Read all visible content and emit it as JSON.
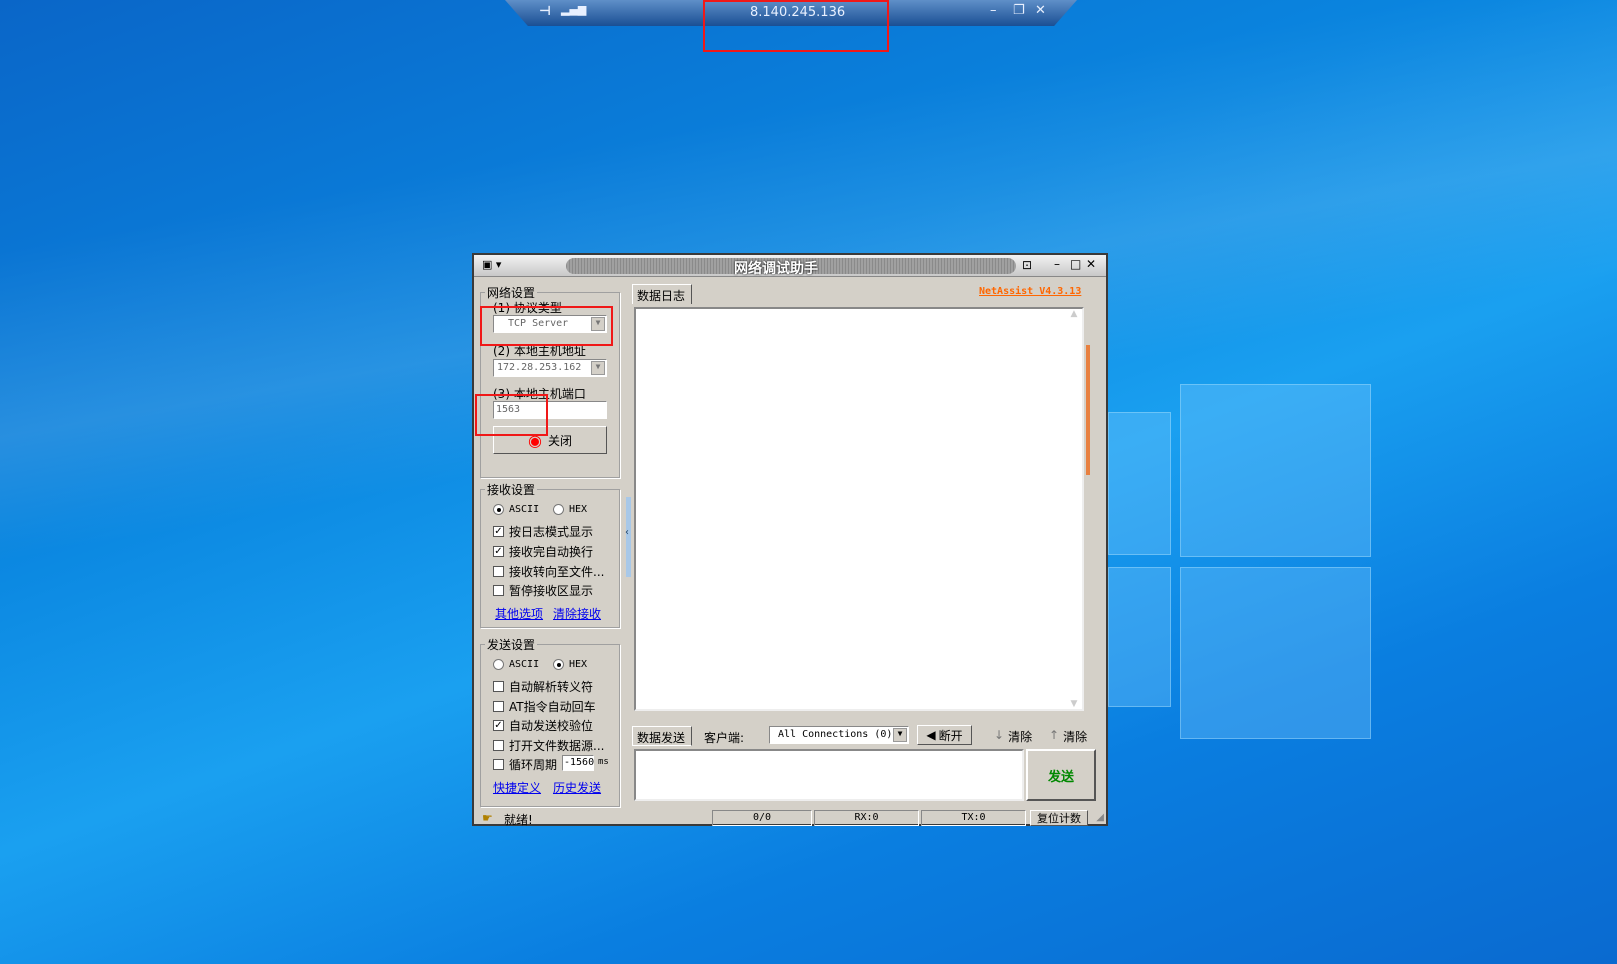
{
  "rdp_bar": {
    "host": "8.140.245.136"
  },
  "app": {
    "title": "网络调试助手",
    "version": "NetAssist V4.3.13",
    "accent": "#ff6600"
  },
  "net": {
    "title": "网络设置",
    "protocol_label": "(1) 协议类型",
    "protocol_value": "TCP Server",
    "host_label": "(2) 本地主机地址",
    "host_value": "172.28.253.162",
    "port_label": "(3) 本地主机端口",
    "port_value": "1563",
    "close_label": "关闭"
  },
  "recv": {
    "title": "接收设置",
    "ascii": "ASCII",
    "hex": "HEX",
    "options": [
      {
        "label": "按日志模式显示",
        "checked": true
      },
      {
        "label": "接收完自动换行",
        "checked": true
      },
      {
        "label": "接收转向至文件...",
        "checked": false
      },
      {
        "label": "暂停接收区显示",
        "checked": false
      }
    ],
    "link_more": "其他选项",
    "link_clear": "清除接收",
    "mode": "ASCII"
  },
  "send": {
    "title": "发送设置",
    "ascii": "ASCII",
    "hex": "HEX",
    "mode": "HEX",
    "options": [
      {
        "label": "自动解析转义符",
        "checked": false
      },
      {
        "label": "AT指令自动回车",
        "checked": false
      },
      {
        "label": "自动发送校验位",
        "checked": true
      },
      {
        "label": "打开文件数据源...",
        "checked": false
      },
      {
        "label": "循环周期",
        "checked": false
      }
    ],
    "period": "-1560",
    "period_unit": "ms",
    "link_shortcut": "快捷定义",
    "link_history": "历史发送"
  },
  "log": {
    "tab": "数据日志"
  },
  "sendbar": {
    "tab": "数据发送",
    "client_label": "客户端:",
    "client_value": "All Connections (0)",
    "disconnect": "断开",
    "clear1": "清除",
    "clear2": "清除",
    "send_button": "发送"
  },
  "status": {
    "text": "就绪!",
    "count": "0/0",
    "rx": "RX:0",
    "tx": "TX:0",
    "reset": "复位计数"
  }
}
